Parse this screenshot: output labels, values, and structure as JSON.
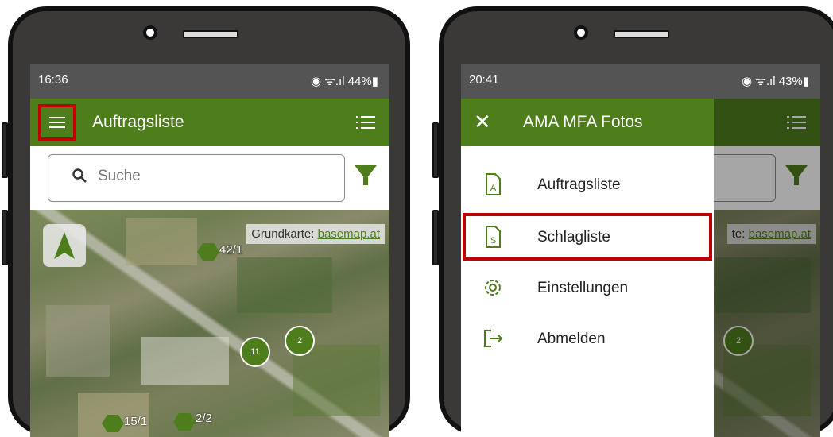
{
  "left_phone": {
    "status": {
      "time": "16:36",
      "indicators": "◉ ᯤ.ıl 44%▮"
    },
    "appbar": {
      "title": "Auftragsliste",
      "menu_icon": "hamburger-icon",
      "list_icon": "list-icon"
    },
    "search": {
      "placeholder": "Suche",
      "icon": "search-icon",
      "filter_icon": "filter-icon"
    },
    "map": {
      "credit_prefix": "Grundkarte: ",
      "credit_link": "basemap.at",
      "markers": [
        "42/1",
        "15/1",
        "2/2"
      ],
      "clusters": [
        "11",
        "2"
      ]
    }
  },
  "right_phone": {
    "status": {
      "time": "20:41",
      "indicators": "◉ ᯤ.ıl 43%▮"
    },
    "drawer": {
      "title": "AMA MFA Fotos",
      "items": [
        {
          "label": "Auftragsliste",
          "icon": "document-a-icon"
        },
        {
          "label": "Schlagliste",
          "icon": "document-s-icon"
        },
        {
          "label": "Einstellungen",
          "icon": "gear-icon"
        },
        {
          "label": "Abmelden",
          "icon": "logout-icon"
        }
      ],
      "selected_item": "Schlagliste"
    },
    "map": {
      "credit_prefix": "te: ",
      "credit_link": "basemap.at",
      "clusters": [
        "2"
      ]
    }
  },
  "colors": {
    "primary_green": "#4e7d1c",
    "highlight_red": "#c00000"
  }
}
